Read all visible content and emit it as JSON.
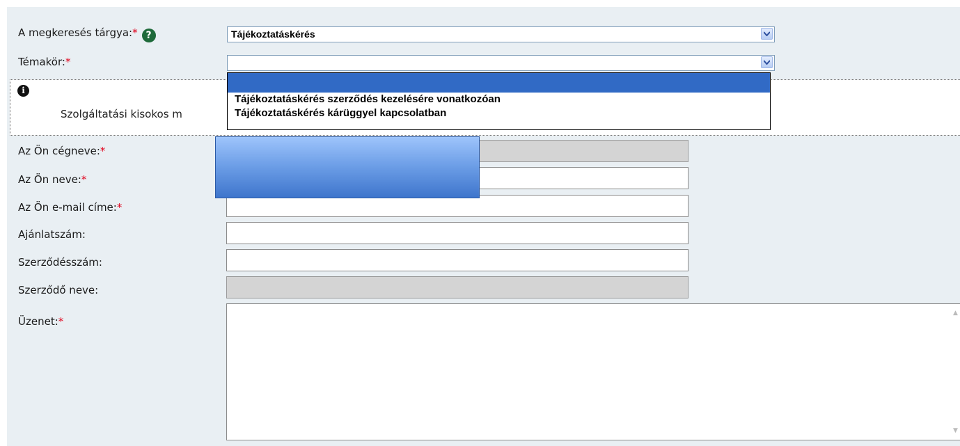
{
  "form": {
    "subject": {
      "label": "A megkeresés tárgya:",
      "required_mark": "*",
      "help_icon": "question-circle-icon",
      "value": "Tájékoztatáskérés"
    },
    "topic": {
      "label": "Témakör:",
      "required_mark": "*",
      "value": "",
      "dropdown_open": true,
      "options": [
        "",
        "Tájékoztatáskérés szerződés kezelésére vonatkozóan",
        "Tájékoztatáskérés kárüggyel kapcsolatban"
      ]
    },
    "info": {
      "icon": "info-circle-icon",
      "text": "Szolgáltatási kisokos m"
    },
    "company_name": {
      "label": "Az Ön cégneve:",
      "required_mark": "*",
      "value": "",
      "disabled": true
    },
    "name": {
      "label": "Az Ön neve:",
      "required_mark": "*",
      "value": ""
    },
    "email": {
      "label": "Az Ön e-mail címe:",
      "required_mark": "*",
      "value": ""
    },
    "offer_number": {
      "label": "Ajánlatszám:",
      "value": ""
    },
    "contract_number": {
      "label": "Szerződésszám:",
      "value": ""
    },
    "contractor_name": {
      "label": "Szerződő neve:",
      "value": "",
      "disabled": true
    },
    "message": {
      "label": "Üzenet:",
      "required_mark": "*",
      "value": ""
    }
  },
  "colors": {
    "panel_bg": "#e9eff3",
    "required": "#e0001a",
    "selection_highlight": "#316ac5",
    "disabled_field": "#d4d4d4"
  }
}
